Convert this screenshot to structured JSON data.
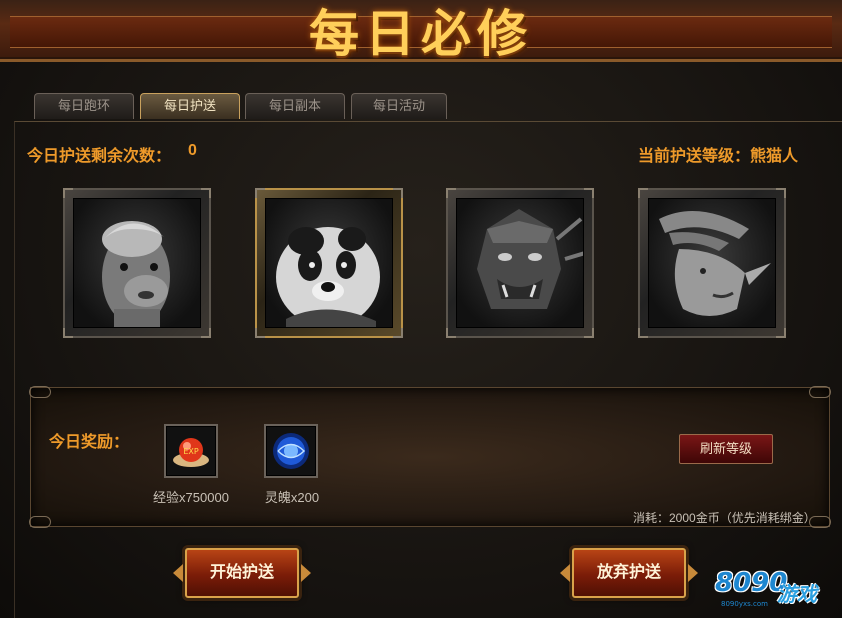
{
  "window": {
    "title": "每日必修"
  },
  "tabs": [
    {
      "label": "每日跑环",
      "active": false
    },
    {
      "label": "每日护送",
      "active": true
    },
    {
      "label": "每日副本",
      "active": false
    },
    {
      "label": "每日活动",
      "active": false
    }
  ],
  "escort": {
    "remaining_label": "今日护送剩余次数：",
    "remaining_count": "0",
    "current_level_text": "当前护送等级：熊猫人",
    "portraits": [
      {
        "icon": "alpaca-portrait",
        "selected": false
      },
      {
        "icon": "panda-portrait",
        "selected": true
      },
      {
        "icon": "armored-orc-portrait",
        "selected": false
      },
      {
        "icon": "troll-portrait",
        "selected": false
      }
    ]
  },
  "reward": {
    "label": "今日奖励：",
    "items": [
      {
        "icon": "experience-orb-icon",
        "caption": "经验x750000"
      },
      {
        "icon": "soul-orb-icon",
        "caption": "灵魄x200"
      }
    ],
    "refresh_button": "刷新等级",
    "cost_text": "消耗：2000金币（优先消耗绑金）"
  },
  "actions": {
    "start_button": "开始护送",
    "abandon_button": "放弃护送"
  },
  "watermark": {
    "number": "8090",
    "text": "游戏",
    "url": "8090yxs.com"
  },
  "colors": {
    "accent": "#ee9a2a",
    "title": "#ffcf5a",
    "button_red": "#7a1c08",
    "frame_gold": "#b99248"
  }
}
